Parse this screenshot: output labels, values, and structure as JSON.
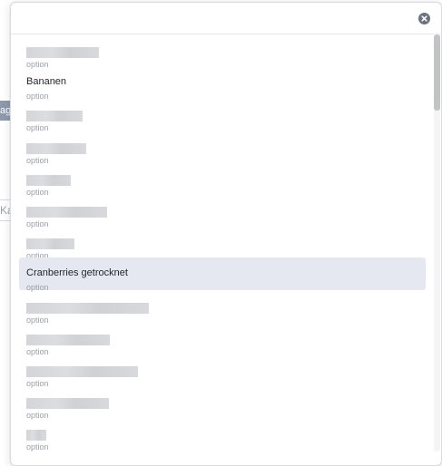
{
  "background": {
    "fragment_1": "ag",
    "fragment_2": "Ka"
  },
  "modal": {
    "close_icon": "close-circle-icon",
    "options": [
      {
        "title": "",
        "subtitle": "option",
        "redacted": true,
        "redact_width": 80
      },
      {
        "title": "Bananen",
        "subtitle": "option",
        "redacted": false
      },
      {
        "title": "",
        "subtitle": "option",
        "redacted": true,
        "redact_width": 62
      },
      {
        "title": "",
        "subtitle": "option",
        "redacted": true,
        "redact_width": 66
      },
      {
        "title": "",
        "subtitle": "option",
        "redacted": true,
        "redact_width": 49
      },
      {
        "title": "",
        "subtitle": "option",
        "redacted": true,
        "redact_width": 89
      },
      {
        "title": "",
        "subtitle": "option",
        "redacted": true,
        "redact_width": 53
      },
      {
        "title": "Cranberries getrocknet",
        "subtitle": "option",
        "redacted": false,
        "selected": true
      },
      {
        "title": "",
        "subtitle": "option",
        "redacted": true,
        "redact_width": 135
      },
      {
        "title": "",
        "subtitle": "option",
        "redacted": true,
        "redact_width": 92
      },
      {
        "title": "",
        "subtitle": "option",
        "redacted": true,
        "redact_width": 123
      },
      {
        "title": "",
        "subtitle": "option",
        "redacted": true,
        "redact_width": 91
      },
      {
        "title": "",
        "subtitle": "option",
        "redacted": true,
        "redact_width": 22
      }
    ]
  },
  "colors": {
    "selected_bg": "#e5e8f1",
    "subtitle": "#9aa0a8",
    "title": "#1f2328"
  }
}
